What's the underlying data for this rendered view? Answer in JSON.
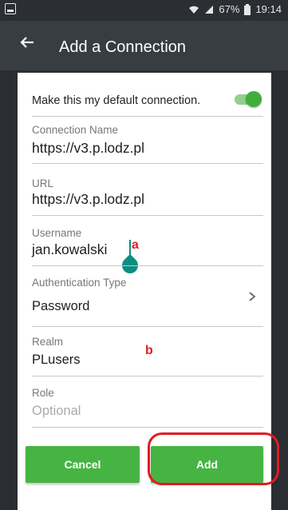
{
  "status_bar": {
    "battery": "67%",
    "time": "19:14"
  },
  "app_bar": {
    "title": "Add a Connection"
  },
  "form": {
    "default_connection_label": "Make this my default connection.",
    "default_connection_on": true,
    "connection_name": {
      "label": "Connection Name",
      "value": "https://v3.p.lodz.pl"
    },
    "url": {
      "label": "URL",
      "value": "https://v3.p.lodz.pl"
    },
    "username": {
      "label": "Username",
      "value": "jan.kowalski"
    },
    "auth_type": {
      "label": "Authentication Type",
      "value": "Password"
    },
    "realm": {
      "label": "Realm",
      "value": "PLusers"
    },
    "role": {
      "label": "Role",
      "placeholder": "Optional"
    }
  },
  "buttons": {
    "cancel": "Cancel",
    "add": "Add"
  },
  "annotations": {
    "a": "a",
    "b": "b"
  },
  "colors": {
    "accent_green": "#46b443",
    "app_bar": "#383d43",
    "highlight_red": "#e01b24",
    "cursor_teal": "#0a8f80"
  }
}
